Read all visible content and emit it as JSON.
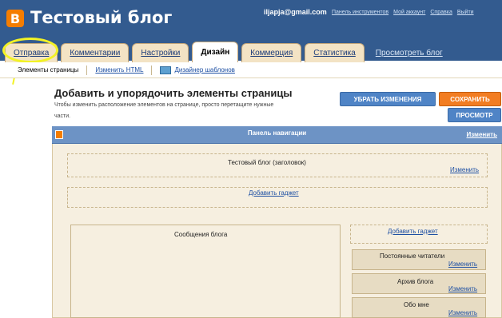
{
  "header": {
    "logo_letter": "B",
    "blog_title": "Тестовый блог",
    "user_email": "iljapja@gmail.com",
    "links": [
      "Панель инструментов",
      "Мой аккаунт",
      "Справка",
      "Выйти"
    ]
  },
  "tabs": [
    {
      "label": "Отправка"
    },
    {
      "label": "Комментарии"
    },
    {
      "label": "Настройки"
    },
    {
      "label": "Дизайн",
      "active": true
    },
    {
      "label": "Коммерция"
    },
    {
      "label": "Статистика"
    },
    {
      "label": "Просмотреть блог"
    }
  ],
  "subtabs": {
    "page_elements": "Элементы страницы",
    "edit_html": "Изменить HTML",
    "template_designer": "Дизайнер шаблонов"
  },
  "main": {
    "heading": "Добавить и упорядочить элементы страницы",
    "description": "Чтобы изменить расположение элементов на странице, просто перетащите нужные части.",
    "revert_button": "УБРАТЬ ИЗМЕНЕНИЯ",
    "save_button": "СОХРАНИТЬ",
    "preview_button": "ПРОСМОТР"
  },
  "layout": {
    "navbar_label": "Панель навигации",
    "navbar_edit": "Изменить",
    "header_widget_title": "Тестовый блог (заголовок)",
    "header_widget_edit": "Изменить",
    "add_gadget_top": "Добавить гаджет",
    "posts_title": "Сообщения блога",
    "add_gadget_sidebar": "Добавить гаджет",
    "followers_title": "Постоянные читатели",
    "followers_edit": "Изменить",
    "archive_title": "Архив блога",
    "archive_edit": "Изменить",
    "about_title": "Обо мне",
    "about_edit": "Изменить"
  },
  "colors": {
    "header_bg": "#335b8f",
    "accent_orange": "#f57d00",
    "button_blue": "#4f84c6",
    "highlight_circle": "#f2f225"
  }
}
